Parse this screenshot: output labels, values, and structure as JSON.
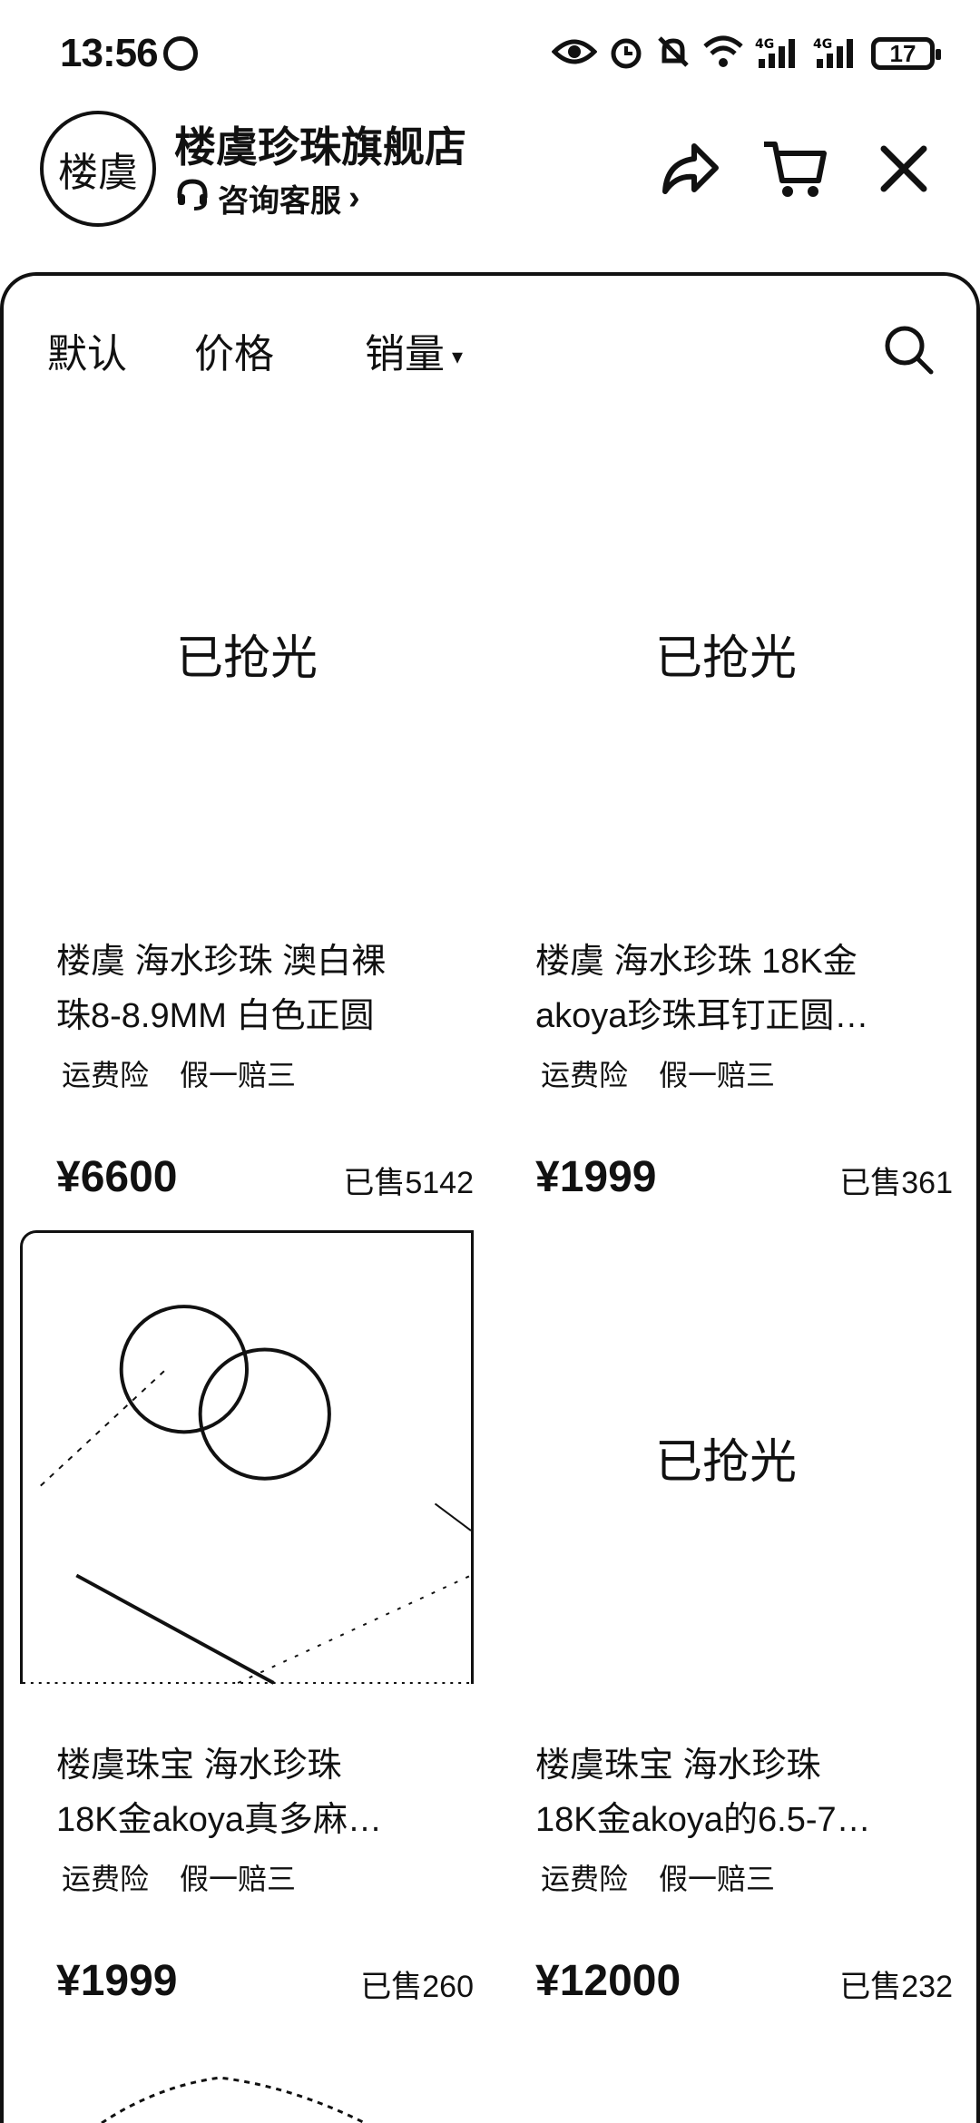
{
  "status": {
    "time": "13:56",
    "battery": "17"
  },
  "store": {
    "logo_text": "楼虞",
    "name": "楼虞珍珠旗舰店",
    "service": "咨询客服",
    "service_arrow": "›"
  },
  "sort": {
    "default": "默认",
    "price": "价格",
    "sales": "销量",
    "sales_caret": "▾"
  },
  "products": [
    {
      "image_text": "已抢光",
      "title_line1": "楼虞 海水珍珠 澳白裸",
      "title_line2": "珠8-8.9MM 白色正圆",
      "tag1": "运费险",
      "tag2": "假一赔三",
      "price": "¥6600",
      "sold": "已售5142"
    },
    {
      "image_text": "已抢光",
      "title_line1": "楼虞 海水珍珠 18K金",
      "title_line2": "akoya珍珠耳钉正圆…",
      "tag1": "运费险",
      "tag2": "假一赔三",
      "price": "¥1999",
      "sold": "已售361"
    },
    {
      "image_text": "",
      "title_line1": "楼虞珠宝 海水珍珠",
      "title_line2": "18K金akoya真多麻…",
      "tag1": "运费险",
      "tag2": "假一赔三",
      "price": "¥1999",
      "sold": "已售260"
    },
    {
      "image_text": "已抢光",
      "title_line1": "楼虞珠宝 海水珍珠",
      "title_line2": "18K金akoya的6.5-7…",
      "tag1": "运费险",
      "tag2": "假一赔三",
      "price": "¥12000",
      "sold": "已售232"
    }
  ]
}
